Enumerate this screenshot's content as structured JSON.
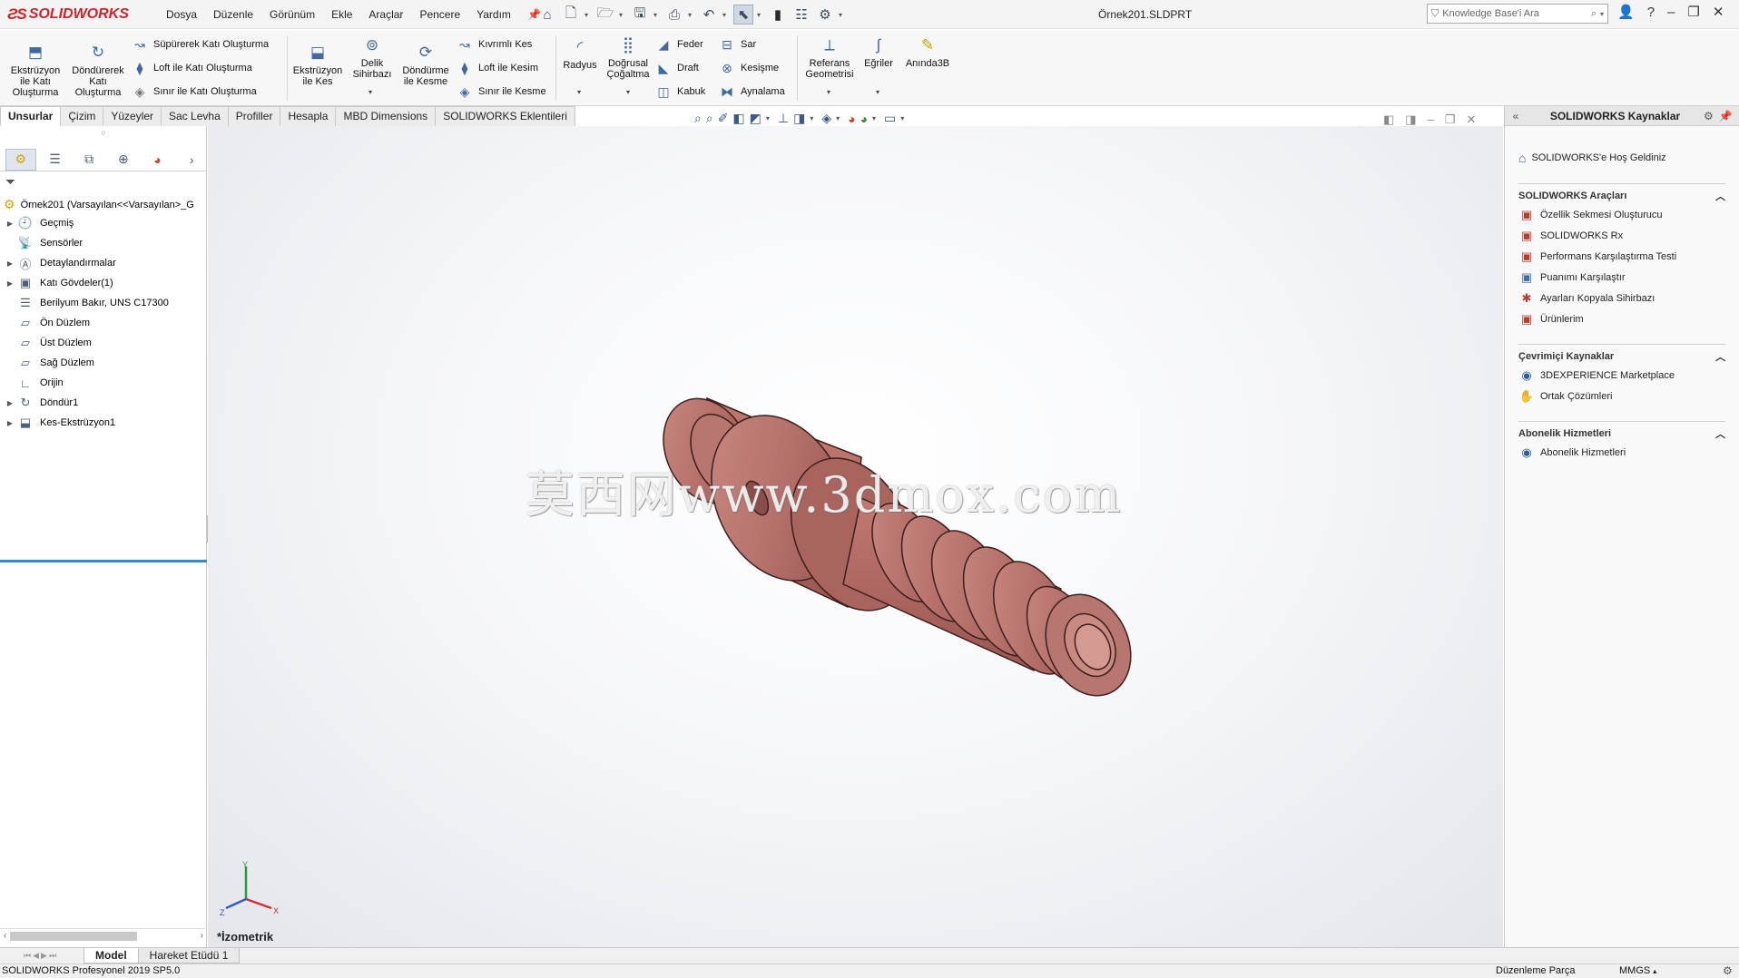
{
  "app": {
    "brand": "SOLIDWORKS",
    "document_title": "Örnek201.SLDPRT"
  },
  "menu": [
    "Dosya",
    "Düzenle",
    "Görünüm",
    "Ekle",
    "Araçlar",
    "Pencere",
    "Yardım"
  ],
  "search": {
    "placeholder": "Knowledge Base'i Ara"
  },
  "commands": {
    "extrude_boss": "Ekstrüzyon\nile Katı\nOluşturma",
    "revolve_boss": "Döndürerek\nKatı\nOluşturma",
    "sweep_boss": "Süpürerek Katı Oluşturma",
    "loft_boss": "Loft ile Katı Oluşturma",
    "boundary_boss": "Sınır ile Katı Oluşturma",
    "extrude_cut": "Ekstrüzyon\nile Kes",
    "hole_wizard": "Delik\nSihirbazı",
    "revolve_cut": "Döndürme\nile Kesme",
    "swept_cut": "Kıvrımlı Kes",
    "loft_cut": "Loft ile Kesim",
    "boundary_cut": "Sınır ile Kesme",
    "fillet": "Radyus",
    "linear_pattern": "Doğrusal\nÇoğaltma",
    "rib": "Feder",
    "draft": "Draft",
    "shell": "Kabuk",
    "wrap": "Sar",
    "intersect": "Kesişme",
    "mirror": "Aynalama",
    "ref_geometry": "Referans\nGeometrisi",
    "curves": "Eğriler",
    "instant3d": "Anında3B"
  },
  "tabs": [
    "Unsurlar",
    "Çizim",
    "Yüzeyler",
    "Sac Levha",
    "Profiller",
    "Hesapla",
    "MBD Dimensions",
    "SOLIDWORKS Eklentileri"
  ],
  "active_tab": "Unsurlar",
  "feature_tree": {
    "root": "Örnek201  (Varsayılan<<Varsayılan>_G",
    "items": [
      {
        "label": "Geçmiş",
        "expandable": true,
        "icon": "history-icon"
      },
      {
        "label": "Sensörler",
        "expandable": false,
        "icon": "sensor-icon"
      },
      {
        "label": "Detaylandırmalar",
        "expandable": true,
        "icon": "annotation-icon"
      },
      {
        "label": "Katı Gövdeler(1)",
        "expandable": true,
        "icon": "solid-bodies-icon"
      },
      {
        "label": "Berilyum Bakır, UNS C17300",
        "expandable": false,
        "icon": "material-icon"
      },
      {
        "label": "Ön Düzlem",
        "expandable": false,
        "icon": "plane-icon"
      },
      {
        "label": "Üst Düzlem",
        "expandable": false,
        "icon": "plane-icon"
      },
      {
        "label": "Sağ Düzlem",
        "expandable": false,
        "icon": "plane-icon"
      },
      {
        "label": "Orijin",
        "expandable": false,
        "icon": "origin-icon"
      },
      {
        "label": "Döndür1",
        "expandable": true,
        "icon": "revolve-feature-icon"
      },
      {
        "label": "Kes-Ekstrüzyon1",
        "expandable": true,
        "icon": "cut-extrude-feature-icon"
      }
    ]
  },
  "viewport": {
    "view_name": "*İzometrik",
    "watermark": "莫西网www.3dmox.com",
    "part_color": "#b5706a",
    "triad": {
      "x": "X",
      "y": "Y",
      "z": "Z"
    }
  },
  "task_pane": {
    "title": "SOLIDWORKS Kaynaklar",
    "welcome": "SOLIDWORKS'e Hoş Geldiniz",
    "sections": [
      {
        "title": "SOLIDWORKS Araçları",
        "items": [
          "Özellik Sekmesi Oluşturucu",
          "SOLIDWORKS Rx",
          "Performans Karşılaştırma Testi",
          "Puanımı Karşılaştır",
          "Ayarları Kopyala Sihirbazı",
          "Ürünlerim"
        ]
      },
      {
        "title": "Çevrimiçi Kaynaklar",
        "items": [
          "3DEXPERIENCE Marketplace",
          "Ortak Çözümleri"
        ]
      },
      {
        "title": "Abonelik Hizmetleri",
        "items": [
          "Abonelik Hizmetleri"
        ]
      }
    ]
  },
  "bottom_tabs": [
    "Model",
    "Hareket Etüdü 1"
  ],
  "status": {
    "version": "SOLIDWORKS Profesyonel 2019 SP5.0",
    "mode": "Düzenleme Parça",
    "units": "MMGS"
  }
}
